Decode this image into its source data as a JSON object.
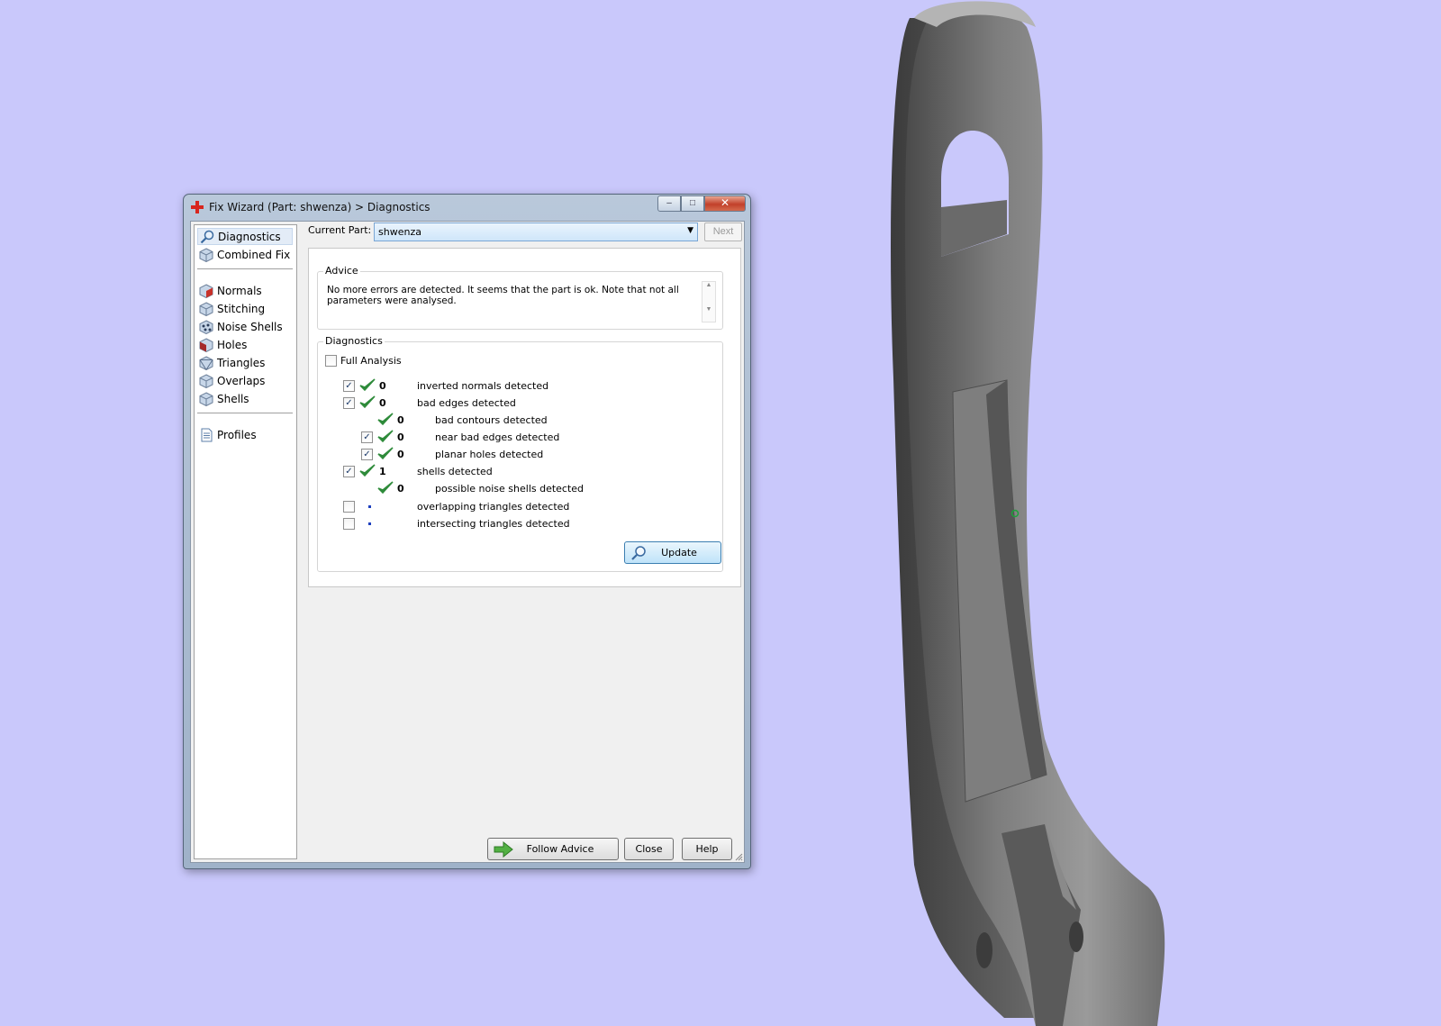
{
  "window": {
    "title": "Fix Wizard (Part: shwenza) > Diagnostics",
    "minimize_label": "–",
    "maximize_label": "□",
    "close_label": "✕"
  },
  "nav": {
    "items": [
      {
        "label": "Diagnostics",
        "icon": "magnifier-icon",
        "selected": true
      },
      {
        "label": "Combined Fix",
        "icon": "cube-icon"
      },
      {
        "label": "Normals",
        "icon": "normals-cube-icon"
      },
      {
        "label": "Stitching",
        "icon": "stitching-cube-icon"
      },
      {
        "label": "Noise Shells",
        "icon": "noise-shells-icon"
      },
      {
        "label": "Holes",
        "icon": "holes-cube-icon"
      },
      {
        "label": "Triangles",
        "icon": "triangles-cube-icon"
      },
      {
        "label": "Overlaps",
        "icon": "overlaps-cube-icon"
      },
      {
        "label": "Shells",
        "icon": "shells-cube-icon"
      },
      {
        "label": "Profiles",
        "icon": "profile-document-icon"
      }
    ]
  },
  "current_part": {
    "label": "Current Part:",
    "value": "shwenza",
    "next_label": "Next"
  },
  "advice": {
    "title": "Advice",
    "text": "No more errors are detected. It seems that the part is ok. Note that not all parameters were analysed."
  },
  "diagnostics": {
    "title": "Diagnostics",
    "full_analysis_label": "Full Analysis",
    "full_analysis_checked": false,
    "rows": [
      {
        "label": "inverted normals detected",
        "count": "0",
        "checked": true,
        "has_checkbox": true,
        "status": "ok"
      },
      {
        "label": "bad edges detected",
        "count": "0",
        "checked": true,
        "has_checkbox": true,
        "status": "ok"
      },
      {
        "label": "bad contours detected",
        "count": "0",
        "checked": false,
        "has_checkbox": false,
        "status": "ok"
      },
      {
        "label": "near bad edges detected",
        "count": "0",
        "checked": true,
        "has_checkbox": true,
        "status": "ok"
      },
      {
        "label": "planar holes detected",
        "count": "0",
        "checked": true,
        "has_checkbox": true,
        "status": "ok"
      },
      {
        "label": "shells detected",
        "count": "1",
        "checked": true,
        "has_checkbox": true,
        "status": "ok"
      },
      {
        "label": "possible noise shells detected",
        "count": "0",
        "checked": false,
        "has_checkbox": false,
        "status": "ok"
      },
      {
        "label": "overlapping triangles detected",
        "count": "",
        "checked": false,
        "has_checkbox": true,
        "status": "pending"
      },
      {
        "label": "intersecting triangles detected",
        "count": "",
        "checked": false,
        "has_checkbox": true,
        "status": "pending"
      }
    ],
    "update_label": "Update"
  },
  "footer": {
    "follow_advice_label": "Follow Advice",
    "close_label": "Close",
    "help_label": "Help"
  },
  "colors": {
    "viewport_background": "#c9c8fb",
    "check_green": "#2e8b3a",
    "pending_blue": "#1d3fbe"
  }
}
